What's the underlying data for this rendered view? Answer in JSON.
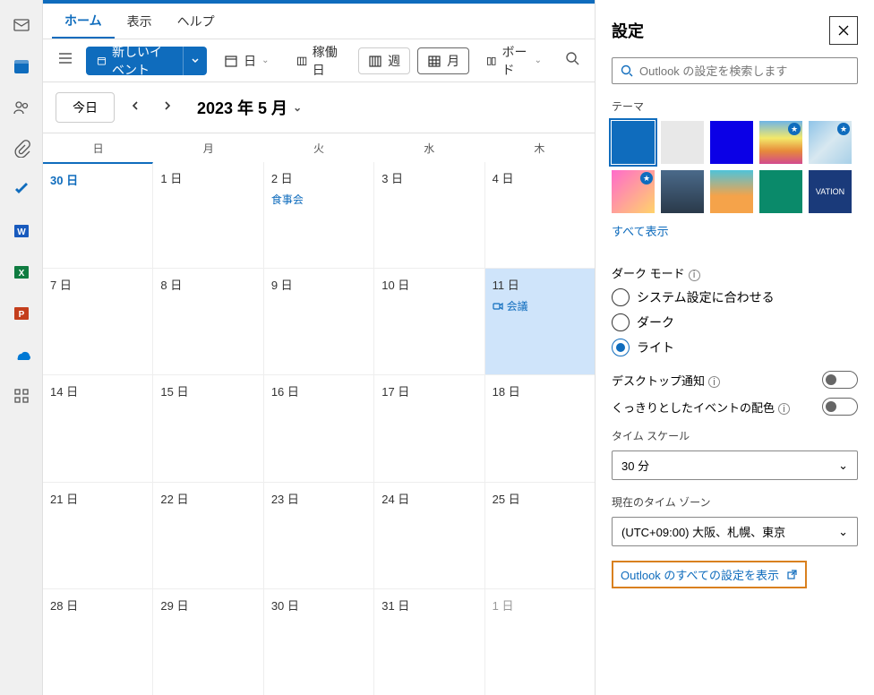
{
  "rail": {
    "items": [
      "mail",
      "calendar",
      "people",
      "attach",
      "todo",
      "word",
      "excel",
      "powerpoint",
      "onedrive",
      "apps"
    ]
  },
  "tabs": {
    "home": "ホーム",
    "view": "表示",
    "help": "ヘルプ"
  },
  "toolbar": {
    "new_event": "新しいイベント",
    "day": "日",
    "workweek": "稼働日",
    "week": "週",
    "month": "月",
    "board": "ボード"
  },
  "datebar": {
    "today": "今日",
    "month_title": "2023 年 5 月"
  },
  "calendar": {
    "dow": [
      "日",
      "月",
      "火",
      "水",
      "木"
    ],
    "weeks": [
      [
        {
          "d": "30 日",
          "today": true,
          "other": false
        },
        {
          "d": "1 日"
        },
        {
          "d": "2 日",
          "evt": "食事会"
        },
        {
          "d": "3 日"
        },
        {
          "d": "4 日"
        }
      ],
      [
        {
          "d": "7 日"
        },
        {
          "d": "8 日"
        },
        {
          "d": "9 日"
        },
        {
          "d": "10 日"
        },
        {
          "d": "11 日",
          "sel": true,
          "evt": "会議",
          "meeting": true
        }
      ],
      [
        {
          "d": "14 日"
        },
        {
          "d": "15 日"
        },
        {
          "d": "16 日"
        },
        {
          "d": "17 日"
        },
        {
          "d": "18 日"
        }
      ],
      [
        {
          "d": "21 日"
        },
        {
          "d": "22 日"
        },
        {
          "d": "23 日"
        },
        {
          "d": "24 日"
        },
        {
          "d": "25 日"
        }
      ],
      [
        {
          "d": "28 日"
        },
        {
          "d": "29 日"
        },
        {
          "d": "30 日"
        },
        {
          "d": "31 日"
        },
        {
          "d": "1 日",
          "other": true
        }
      ]
    ]
  },
  "panel": {
    "title": "設定",
    "search_placeholder": "Outlook の設定を検索します",
    "theme_label": "テーマ",
    "show_all": "すべて表示",
    "dark_mode_label": "ダーク モード",
    "dark_options": {
      "system": "システム設定に合わせる",
      "dark": "ダーク",
      "light": "ライト"
    },
    "desktop_notif": "デスクトップ通知",
    "event_color": "くっきりとしたイベントの配色",
    "time_scale_label": "タイム スケール",
    "time_scale_value": "30 分",
    "tz_label": "現在のタイム ゾーン",
    "tz_value": "(UTC+09:00) 大阪、札幌、東京",
    "all_settings": "Outlook のすべての設定を表示"
  }
}
